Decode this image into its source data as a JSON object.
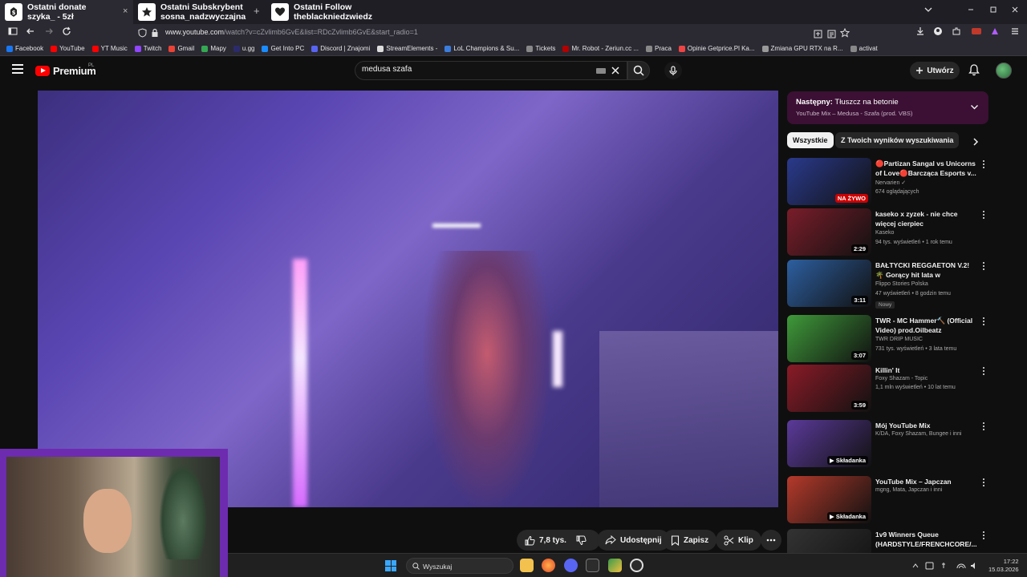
{
  "browser": {
    "tabs": [
      {
        "title": "Ostatni donate\nszyka_ - 5zł",
        "icon": "coin-icon"
      },
      {
        "title": "Ostatni Subskrybent\nsosna_nadzwyczajna",
        "icon": "star-icon"
      },
      {
        "title": "Ostatni Follow\ntheblackniedzwiedz",
        "icon": "heart-icon"
      }
    ],
    "tab_close": "×",
    "new_tab": "+",
    "url_host": "www.youtube.com",
    "url_path": "/watch?v=cZvlimb6GvE&list=RDcZvlimb6GvE&start_radio=1",
    "bookmarks": [
      {
        "label": "Facebook",
        "color": "#1877f2"
      },
      {
        "label": "YouTube",
        "color": "#ff0000"
      },
      {
        "label": "YT Music",
        "color": "#ff0000"
      },
      {
        "label": "Twitch",
        "color": "#9146ff"
      },
      {
        "label": "Gmail",
        "color": "#ea4335"
      },
      {
        "label": "Mapy",
        "color": "#34a853"
      },
      {
        "label": "u.gg",
        "color": "#2b2b6b"
      },
      {
        "label": "Get Into PC",
        "color": "#1a8cff"
      },
      {
        "label": "Discord | Znajomi",
        "color": "#5865f2"
      },
      {
        "label": "StreamElements -",
        "color": "#dddddd"
      },
      {
        "label": "LoL Champions & Su...",
        "color": "#3b7ddd"
      },
      {
        "label": "Tickets",
        "color": "#888888"
      },
      {
        "label": "Mr. Robot - Zeriun.cc ...",
        "color": "#b30000"
      },
      {
        "label": "Praca",
        "color": "#888888"
      },
      {
        "label": "Opinie Getprice.Pl Ka...",
        "color": "#e44"
      },
      {
        "label": "Zmiana GPU RTX na R...",
        "color": "#999999"
      },
      {
        "label": "activat",
        "color": "#888888"
      }
    ]
  },
  "youtube": {
    "logo_text": "Premium",
    "logo_region": "PL",
    "search_value": "medusa szafa",
    "create_label": "Utwórz",
    "actions": {
      "like_count": "7,8 tys.",
      "share": "Udostępnij",
      "save": "Zapisz",
      "clip": "Klip"
    },
    "up_next": {
      "prefix": "Następny:",
      "title": "Tłuszcz na betonie",
      "subtitle": "YouTube Mix – Medusa - Szafa (prod. VBS)"
    },
    "chips": [
      "Wszystkie",
      "Z Twoich wyników wyszukiwania"
    ],
    "recommendations": [
      {
        "title": "🔴Partizan Sangal vs Unicorns of Love🔴Barcząca Esports  v...",
        "channel": "Nervarien ✓",
        "meta": "674 oglądających",
        "badge": "NA ŻYWO",
        "live": true,
        "thumb_color": "#2a3a8c"
      },
      {
        "title": "kaseko x zyzek - nie chce więcej cierpiec",
        "channel": "Kaseko",
        "meta": "94 tys. wyświetleń • 1 rok temu",
        "badge": "2:29",
        "live": false,
        "thumb_color": "#7a1d2a"
      },
      {
        "title": "BAŁTYCKI REGGAETON V.2! 🌴 Gorący hit lata w Trójmieście ...",
        "channel": "Flippo Stories Polska",
        "meta": "47 wyświetleń • 8 godzin temu",
        "badge": "3:11",
        "live": false,
        "tag": "Nowy",
        "thumb_color": "#2d5fa0"
      },
      {
        "title": "TWR - MC Hammer🔨 (Official Video) prod.Oilbeatz",
        "channel": "TWR DRIP MUSIC",
        "meta": "731 tys. wyświetleń • 3 lata temu",
        "badge": "3:07",
        "live": false,
        "thumb_color": "#3f9a3a"
      },
      {
        "title": "Killin' It",
        "channel": "Foxy Shazam - Topic",
        "meta": "1,1 mln wyświetleń • 10 lat temu",
        "badge": "3:59",
        "live": false,
        "thumb_color": "#8a1b27"
      },
      {
        "title": "Mój YouTube Mix",
        "channel": "K/DA, Foxy Shazam, Bungee i inni",
        "meta": "",
        "badge": "▶ Składanka",
        "live": false,
        "thumb_color": "#5b3a9a"
      },
      {
        "title": "YouTube Mix – Japczan",
        "channel": "mgng, Mata, Japczan i inni",
        "meta": "",
        "badge": "▶ Składanka",
        "live": false,
        "thumb_color": "#b53a2b"
      },
      {
        "title": "1v9 Winners Queue (HARDSTYLE/FRENCHCORE/...",
        "channel": "",
        "meta": "",
        "badge": "",
        "live": false,
        "thumb_color": "#333333"
      }
    ]
  },
  "taskbar": {
    "search_placeholder": "Wyszukaj",
    "time": "17:22",
    "date": "15.03.2026"
  }
}
